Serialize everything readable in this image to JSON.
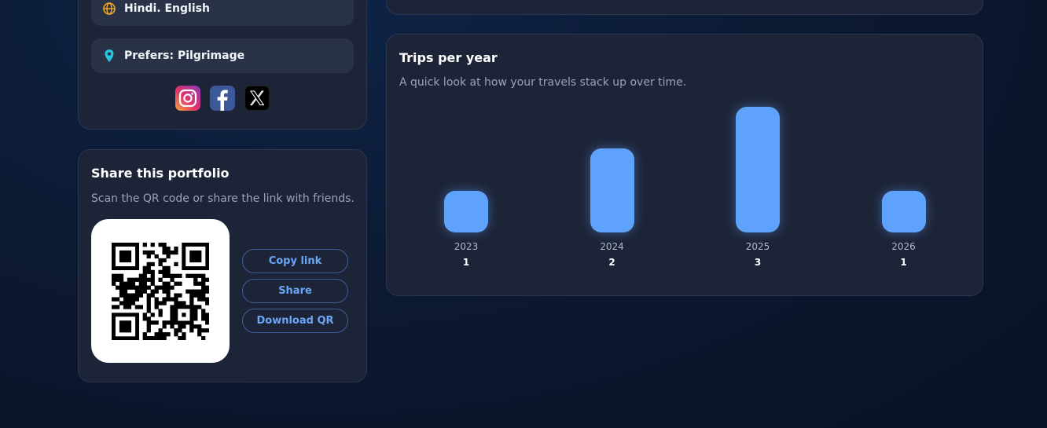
{
  "profile": {
    "languages": "Hindi. English",
    "prefers": "Prefers: Pilgrimage",
    "socials": [
      {
        "name": "instagram-icon"
      },
      {
        "name": "facebook-icon"
      },
      {
        "name": "x-icon"
      }
    ]
  },
  "share": {
    "title": "Share this portfolio",
    "subtitle": "Scan the QR code or share the link with friends.",
    "buttons": {
      "copy_link": "Copy link",
      "share": "Share",
      "download_qr": "Download QR"
    }
  },
  "chart": {
    "title": "Trips per year",
    "subtitle": "A quick look at how your travels stack up over time."
  },
  "chart_data": {
    "type": "bar",
    "title": "Trips per year",
    "categories": [
      "2023",
      "2024",
      "2025",
      "2026"
    ],
    "values": [
      1,
      2,
      3,
      1
    ],
    "ylim": [
      0,
      3
    ],
    "grid": false,
    "bar_color": "#5ea2fb"
  },
  "colors": {
    "accent": "#5ea2fb",
    "button_text": "#6aa6f8",
    "card_bg": "#1d2437"
  }
}
